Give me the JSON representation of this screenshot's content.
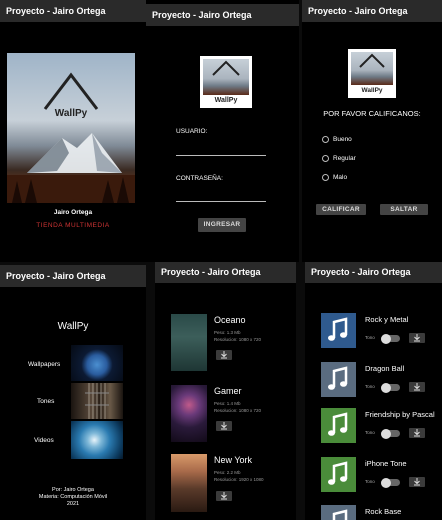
{
  "app_title": "Proyecto - Jairo Ortega",
  "splash": {
    "logo_text": "WallPy",
    "author": "Jairo Ortega",
    "store": "TIENDA MULTIMEDIA"
  },
  "login": {
    "logo_text": "WallPy",
    "user_label": "USUARIO:",
    "password_label": "CONTRASEÑA:",
    "login_button": "INGRESAR"
  },
  "rating": {
    "logo_text": "WallPy",
    "prompt": "POR FAVOR CALIFICANOS:",
    "options": [
      "Bueno",
      "Regular",
      "Malo"
    ],
    "rate_button": "CALIFICAR",
    "skip_button": "SALTAR"
  },
  "menu": {
    "title": "WallPy",
    "items": [
      "Wallpapers",
      "Tones",
      "Videos"
    ],
    "footer": [
      "Por: Jairo Ortega",
      "Materia: Computación Móvil",
      "2021"
    ]
  },
  "wallpapers": [
    {
      "name": "Oceano",
      "weight": "Peso: 1.3 Mb",
      "resolution": "Resolucion: 1080 x 720"
    },
    {
      "name": "Gamer",
      "weight": "Peso: 1.4 Mb",
      "resolution": "Resolucion: 1080 x 720"
    },
    {
      "name": "New York",
      "weight": "Peso: 2.2 Mb",
      "resolution": "Resolucion: 1920 x 1080"
    }
  ],
  "tones": {
    "toggle_label": "Tono",
    "items": [
      "Rock y Metal",
      "Dragon Ball",
      "Friendship by Pascal",
      "iPhone Tone",
      "Rock Base"
    ],
    "icon_colors": [
      "#2f5a8e",
      "#5a6c80",
      "#4a8c3a",
      "#4a8c3a",
      "#5a6c80"
    ]
  },
  "icons": [
    "download-icon",
    "music-note-icon",
    "mountain-logo-icon"
  ]
}
